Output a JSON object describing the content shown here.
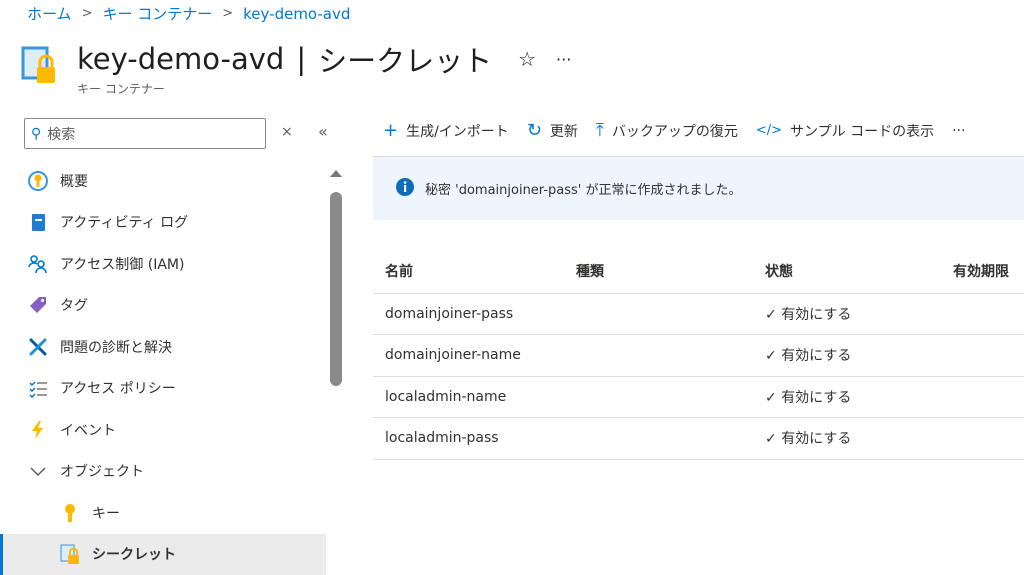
{
  "breadcrumb": [
    "ホーム",
    "キー コンテナー",
    "key-demo-avd"
  ],
  "header": {
    "resource": "key-demo-avd",
    "separator": "|",
    "page": "シークレット",
    "subtitle": "キー コンテナー",
    "star": "☆",
    "more": "···"
  },
  "search": {
    "placeholder": "検索",
    "clear": "×",
    "collapse": "«"
  },
  "sidebar": {
    "items": [
      {
        "label": "概要",
        "icon": "key-circle-icon"
      },
      {
        "label": "アクティビティ ログ",
        "icon": "log-icon"
      },
      {
        "label": "アクセス制御 (IAM)",
        "icon": "people-icon"
      },
      {
        "label": "タグ",
        "icon": "tag-icon"
      },
      {
        "label": "問題の診断と解決",
        "icon": "wrench-icon"
      },
      {
        "label": "アクセス ポリシー",
        "icon": "checklist-icon"
      },
      {
        "label": "イベント",
        "icon": "lightning-icon"
      },
      {
        "label": "オブジェクト",
        "icon": "chevron-down-icon"
      },
      {
        "label": "キー",
        "icon": "key-icon"
      },
      {
        "label": "シークレット",
        "icon": "secret-icon"
      }
    ]
  },
  "toolbar": {
    "generate": "生成/インポート",
    "refresh": "更新",
    "restore": "バックアップの復元",
    "sample": "サンプル コードの表示",
    "more": "···"
  },
  "banner": {
    "message": "秘密 'domainjoiner-pass' が正常に作成されました。"
  },
  "table": {
    "headers": [
      "名前",
      "種類",
      "状態",
      "有効期限"
    ],
    "rows": [
      {
        "name": "domainjoiner-pass",
        "type": "",
        "status": "有効にする"
      },
      {
        "name": "domainjoiner-name",
        "type": "",
        "status": "有効にする"
      },
      {
        "name": "localadmin-name",
        "type": "",
        "status": "有効にする"
      },
      {
        "name": "localadmin-pass",
        "type": "",
        "status": "有効にする"
      }
    ]
  },
  "colors": {
    "accent": "#0078d4",
    "banner": "#eef5fd"
  }
}
